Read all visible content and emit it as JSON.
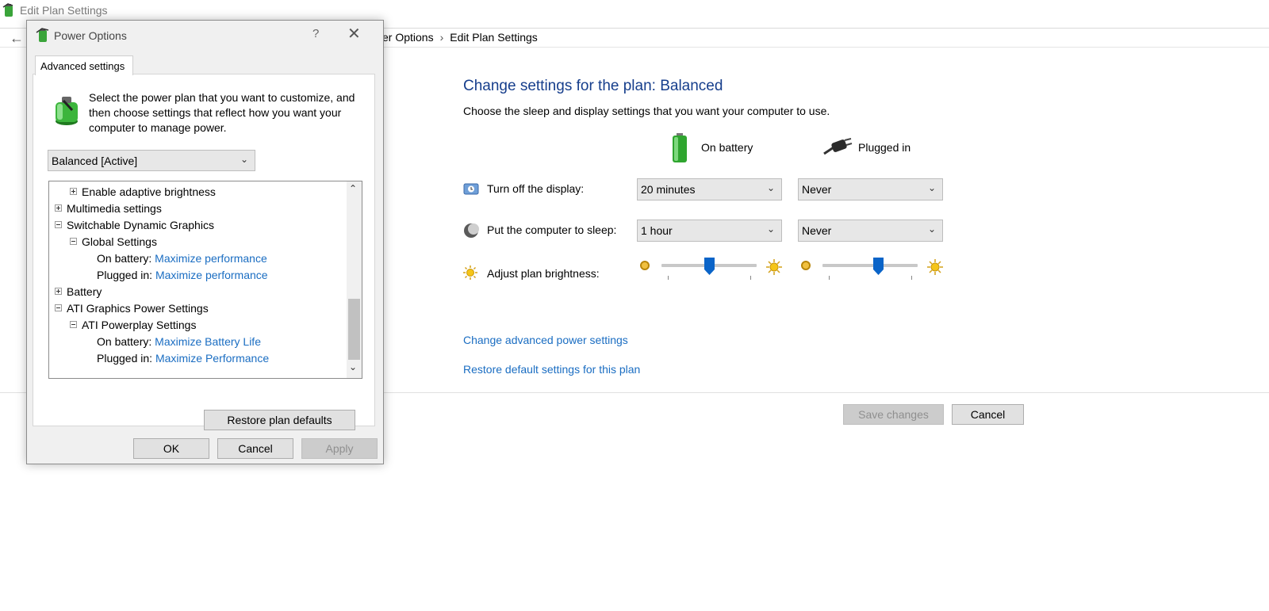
{
  "window": {
    "title": "Edit Plan Settings"
  },
  "address_bar": {
    "crumbs": [
      "ver Options",
      "Edit Plan Settings"
    ]
  },
  "main": {
    "heading": "Change settings for the plan: Balanced",
    "subheading": "Choose the sleep and display settings that you want your computer to use.",
    "columns": {
      "battery": "On battery",
      "plugged": "Plugged in"
    },
    "rows": {
      "display": {
        "label": "Turn off the display:",
        "battery": "20 minutes",
        "plugged": "Never"
      },
      "sleep": {
        "label": "Put the computer to sleep:",
        "battery": "1 hour",
        "plugged": "Never"
      },
      "brightness": {
        "label": "Adjust plan brightness:",
        "battery_level": 0.5,
        "plugged_level": 0.58
      }
    },
    "links": {
      "advanced": "Change advanced power settings",
      "restore": "Restore default settings for this plan"
    },
    "buttons": {
      "save": "Save changes",
      "cancel": "Cancel"
    }
  },
  "dialog": {
    "title": "Power Options",
    "help": "?",
    "tab": "Advanced settings",
    "intro": "Select the power plan that you want to customize, and then choose settings that reflect how you want your computer to manage power.",
    "plan": "Balanced [Active]",
    "tree": {
      "adaptive": "Enable adaptive brightness",
      "multimedia": "Multimedia settings",
      "sdg": "Switchable Dynamic Graphics",
      "global": "Global Settings",
      "on_battery_label": "On battery:",
      "plugged_label": "Plugged in:",
      "sdg_battery": "Maximize performance",
      "sdg_plugged": "Maximize performance",
      "battery": "Battery",
      "ati": "ATI Graphics Power Settings",
      "powerplay": "ATI Powerplay Settings",
      "ati_battery": "Maximize Battery Life",
      "ati_plugged": "Maximize Performance"
    },
    "buttons": {
      "restore": "Restore plan defaults",
      "ok": "OK",
      "cancel": "Cancel",
      "apply": "Apply"
    }
  },
  "colors": {
    "link": "#1a6dc2",
    "heading": "#163e8c",
    "slider_thumb": "#0a64c8"
  }
}
